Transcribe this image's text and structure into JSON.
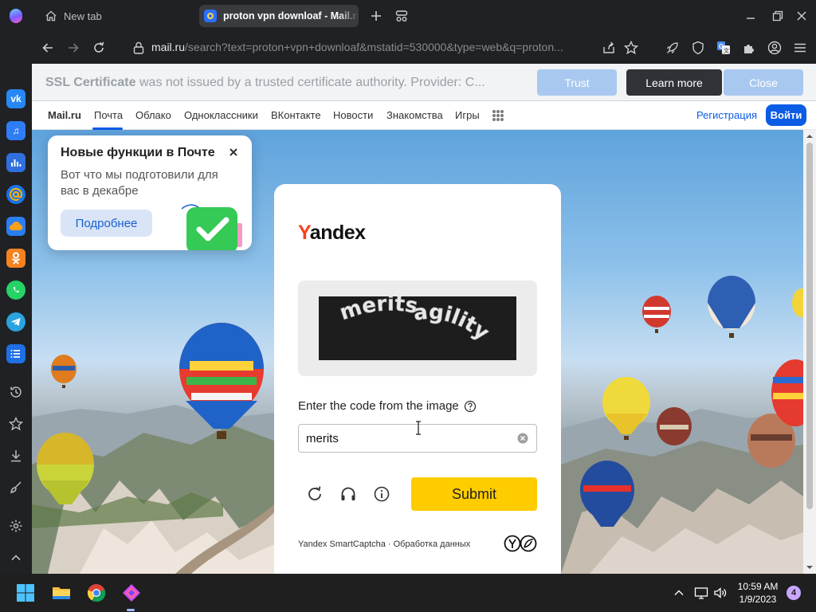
{
  "browser": {
    "tabs": [
      {
        "title": "New tab"
      },
      {
        "title": "proton vpn downloaf - Mail.ru"
      }
    ],
    "url": {
      "host": "mail.ru",
      "rest": "/search?text=proton+vpn+downloaf&mstatid=530000&type=web&q=proton..."
    }
  },
  "ssl_banner": {
    "title": "SSL Certificate",
    "message": "was not issued by a trusted certificate authority. Provider: C...",
    "trust_label": "Trust",
    "learn_label": "Learn more",
    "close_label": "Close"
  },
  "topnav": {
    "brand": "Mail.ru",
    "items": [
      "Почта",
      "Облако",
      "Одноклассники",
      "ВКонтакте",
      "Новости",
      "Знакомства",
      "Игры"
    ],
    "register": "Регистрация",
    "login": "Войти"
  },
  "popup": {
    "title": "Новые функции в Почте",
    "body": "Вот что мы подготовили для вас в декабре",
    "button": "Подробнее"
  },
  "captcha": {
    "logo_initial": "Y",
    "logo_rest": "andex",
    "image_text_1": "merits",
    "image_text_2": "agility",
    "label": "Enter the code from the image",
    "input_value": "merits",
    "submit_label": "Submit",
    "footer": "Yandex SmartCaptcha · Обработка данных"
  },
  "sidebar": {
    "apps": [
      "vk",
      "music",
      "stats",
      "mail",
      "cloud",
      "ok",
      "whatsapp",
      "telegram",
      "list"
    ]
  },
  "taskbar": {
    "time": "10:59 AM",
    "date": "1/9/2023",
    "notifications": "4"
  },
  "colors": {
    "accent": "#0a5ce5",
    "submit": "#ffcc00",
    "yandex_red": "#fc3f1d"
  }
}
